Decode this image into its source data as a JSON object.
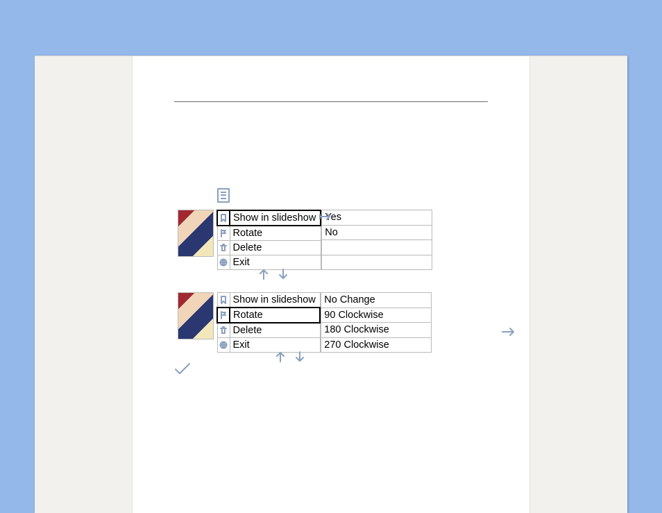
{
  "menu1": {
    "items": [
      {
        "label": "Show in slideshow",
        "icon": "bookmark"
      },
      {
        "label": "Rotate",
        "icon": "flag"
      },
      {
        "label": "Delete",
        "icon": "trash"
      },
      {
        "label": "Exit",
        "icon": "globe"
      }
    ],
    "options": [
      "Yes",
      "No",
      "",
      ""
    ],
    "selected_item_index": 0,
    "selected_option_index": null
  },
  "menu2": {
    "items": [
      {
        "label": "Show in slideshow",
        "icon": "bookmark"
      },
      {
        "label": "Rotate",
        "icon": "flag"
      },
      {
        "label": "Delete",
        "icon": "trash"
      },
      {
        "label": "Exit",
        "icon": "globe"
      }
    ],
    "options": [
      "No Change",
      "90 Clockwise",
      "180 Clockwise",
      "270 Clockwise"
    ],
    "selected_item_index": 1,
    "selected_option_index": null
  },
  "icons": {
    "arrow_up": "up",
    "arrow_down": "down",
    "arrow_right": "right",
    "check": "check",
    "clipboard": "clipboard",
    "pointer": "pointer"
  }
}
